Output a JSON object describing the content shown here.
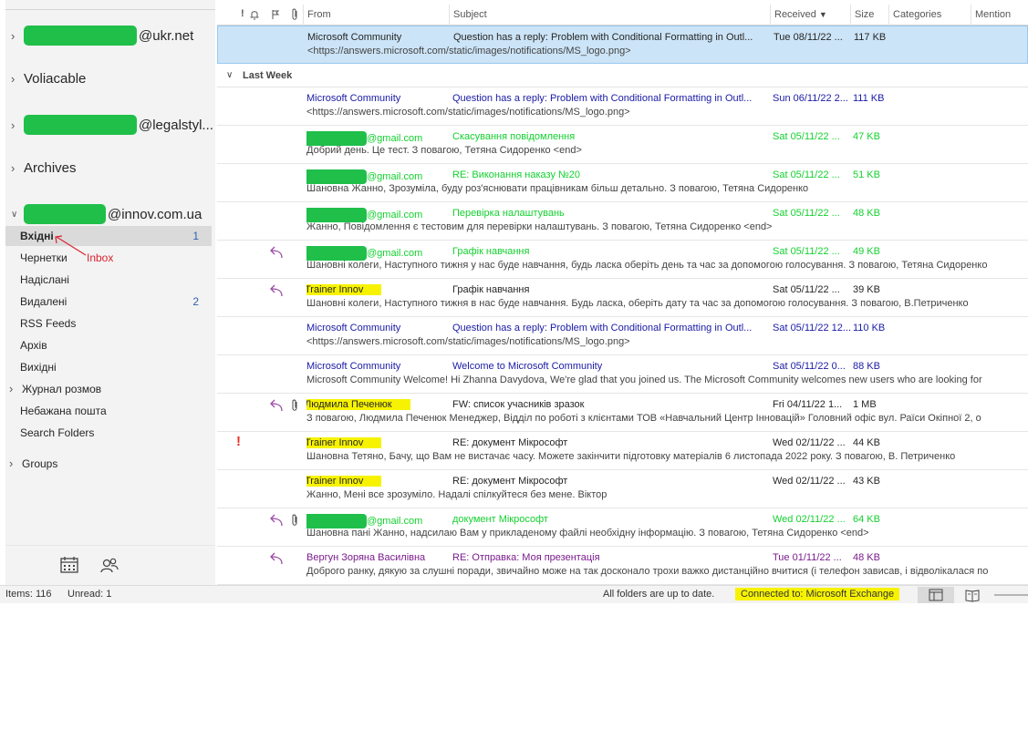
{
  "accounts": {
    "acc1_suffix": "@ukr.net",
    "acc2": "Voliacable",
    "acc3_suffix": "@legalstyl...",
    "acc4": "Archives",
    "acc5_suffix": "@innov.com.ua"
  },
  "folders": [
    {
      "label": "Вхідні",
      "count": "1"
    },
    {
      "label": "Чернетки",
      "count": ""
    },
    {
      "label": "Надіслані",
      "count": ""
    },
    {
      "label": "Видалені",
      "count": "2"
    },
    {
      "label": "RSS Feeds",
      "count": ""
    },
    {
      "label": "Архів",
      "count": ""
    },
    {
      "label": "Вихідні",
      "count": ""
    },
    {
      "label": "Журнал розмов",
      "count": ""
    },
    {
      "label": "Небажана пошта",
      "count": ""
    },
    {
      "label": "Search Folders",
      "count": ""
    },
    {
      "label": "Groups",
      "count": ""
    }
  ],
  "annotation": {
    "label": "Inbox",
    "color": "#d9232e"
  },
  "columns": {
    "importance": "!",
    "from": "From",
    "subject": "Subject",
    "received": "Received",
    "size": "Size",
    "categories": "Categories",
    "mention": "Mention"
  },
  "group_last_week": "Last Week",
  "messages": [
    {
      "from": "Microsoft Community",
      "subject": "Question has a reply: Problem with Conditional Formatting in Outl...",
      "received": "Tue 08/11/22 ...",
      "size": "117 KB",
      "preview": "<https://answers.microsoft.com/static/images/notifications/MS_logo.png>"
    },
    {
      "from": "Microsoft Community",
      "subject": "Question has a reply: Problem with Conditional Formatting in Outl...",
      "received": "Sun 06/11/22 2...",
      "size": "111 KB",
      "preview": "<https://answers.microsoft.com/static/images/notifications/MS_logo.png>"
    },
    {
      "from": "@gmail.com",
      "subject": "Скасування повідомлення",
      "received": "Sat 05/11/22 ...",
      "size": "47 KB",
      "preview": "Добрий день. Це тест.  З повагою,  Тетяна Сидоренко <end>"
    },
    {
      "from": "@gmail.com",
      "subject": "RE: Виконання наказу №20",
      "received": "Sat 05/11/22 ...",
      "size": "51 KB",
      "preview": "Шановна Жанно,  Зрозуміла, буду роз'яснювати працівникам більш детально.  З повагою,  Тетяна Сидоренко"
    },
    {
      "from": "@gmail.com",
      "subject": "Перевірка налаштувань",
      "received": "Sat 05/11/22 ...",
      "size": "48 KB",
      "preview": "Жанно,  Повідомлення є тестовим для перевірки налаштувань.  З повагою,  Тетяна Сидоренко <end>"
    },
    {
      "from": "@gmail.com",
      "subject": "Графік навчання",
      "received": "Sat 05/11/22 ...",
      "size": "49 KB",
      "preview": "Шановні колеги,  Наступного тижня у нас буде навчання, будь ласка оберіть день та час за допомогою голосування.  З повагою,  Тетяна Сидоренко"
    },
    {
      "from": "Trainer Innov",
      "subject": "Графік навчання",
      "received": "Sat 05/11/22 ...",
      "size": "39 KB",
      "preview": "Шановні колеги,   Наступного тижня в нас буде навчання. Будь ласка, оберіть дату та час за допомогою голосування.  З повагою,   В.Петриченко"
    },
    {
      "from": "Microsoft Community",
      "subject": "Question has a reply: Problem with Conditional Formatting in Outl...",
      "received": "Sat 05/11/22 12...",
      "size": "110 KB",
      "preview": "<https://answers.microsoft.com/static/images/notifications/MS_logo.png>"
    },
    {
      "from": "Microsoft Community",
      "subject": "Welcome to Microsoft Community",
      "received": "Sat 05/11/22 0...",
      "size": "88 KB",
      "preview": "Microsoft Community  Welcome!  Hi Zhanna Davydova,  We're glad that you joined us. The Microsoft Community welcomes new users who are looking for"
    },
    {
      "from": "Людмила Печенюк",
      "subject": "FW: список учасників  зразок",
      "received": "Fri 04/11/22 1...",
      "size": "1 MB",
      "preview": "З повагою,  Людмила Печенюк  Менеджер,  Відділ по роботі з клієнтами  ТОВ «Навчальний Центр Інновацій»  Головний офіс  вул. Раїси Окіпної 2, о"
    },
    {
      "from": "Trainer Innov",
      "subject": "RE: документ Мікрософт",
      "received": "Wed 02/11/22 ...",
      "size": "44 KB",
      "preview": "Шановна Тетяно,  Бачу, що Вам не вистачає часу. Можете закінчити підготовку матеріалів 6 листопада 2022 року.  З повагою,  В. Петриченко"
    },
    {
      "from": "Trainer Innov",
      "subject": "RE: документ Мікрософт",
      "received": "Wed 02/11/22 ...",
      "size": "43 KB",
      "preview": "Жанно,  Мені все зрозуміло. Надалі спілкуйтеся без мене.  Віктор"
    },
    {
      "from": "@gmail.com",
      "subject": "документ Мікрософт",
      "received": "Wed 02/11/22 ...",
      "size": "64 KB",
      "preview": "Шановна пані Жанно,  надсилаю Вам у прикладеному файлі необхідну інформацію.  З повагою,  Тетяна Сидоренко <end>"
    },
    {
      "from": "Вергун Зоряна Василівна",
      "subject": "RE: Отправка: Моя презентація",
      "received": "Tue 01/11/22 ...",
      "size": "48 KB",
      "preview": "Доброго ранку, дякую за слушні  поради, звичайно може на так досконало трохи важко дистанційно вчитися (і телефон зависав, і відволікалася по"
    }
  ],
  "status": {
    "items": "Items: 116",
    "unread": "Unread: 1",
    "sync": "All folders are up to date.",
    "connection": "Connected to: Microsoft Exchange"
  },
  "colors": {
    "unread": "#1a1aa6",
    "conditional_green": "#13d12f",
    "purple_sender": "#7a1b8c",
    "highlight": "#f7f300",
    "redaction": "#1fbf4a",
    "selected_row": "#cce4f7"
  },
  "icons": [
    "reply-icon",
    "attachment-icon",
    "flag-icon",
    "calendar-icon",
    "people-icon",
    "reading-pane-icon",
    "book-icon"
  ]
}
